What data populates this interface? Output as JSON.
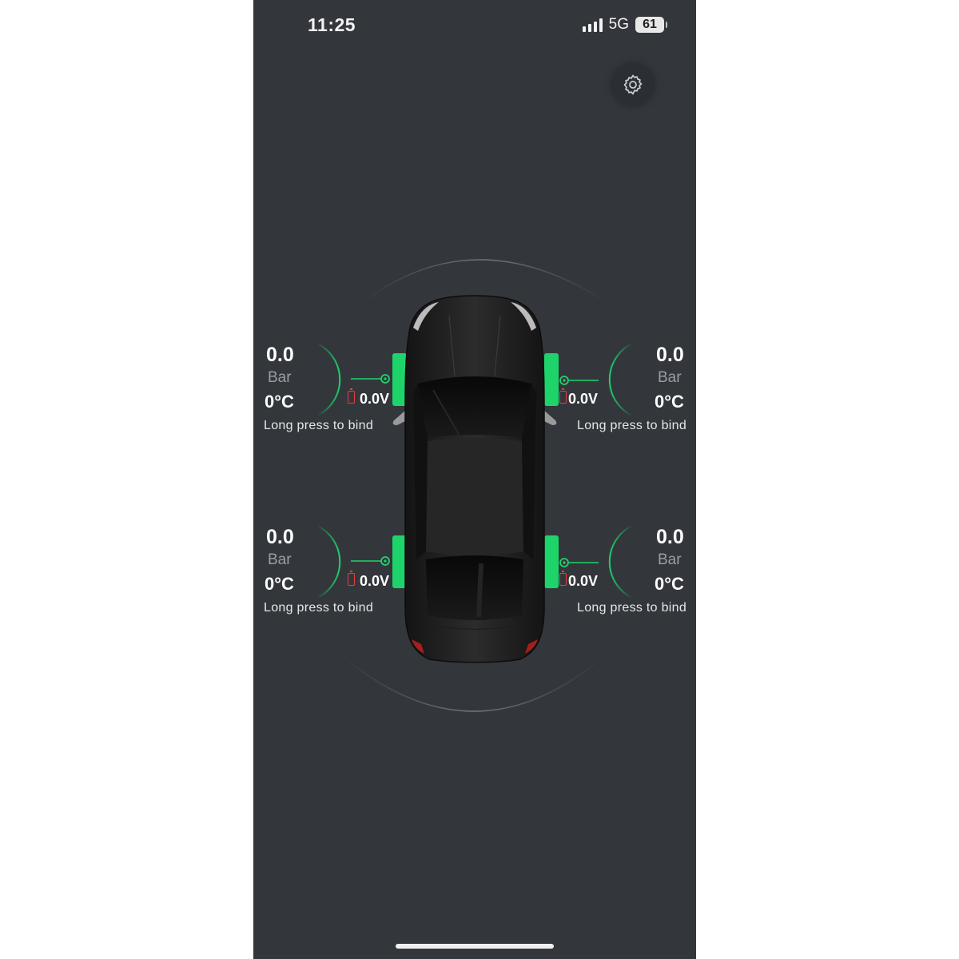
{
  "status_bar": {
    "time": "11:25",
    "network": "5G",
    "battery_level": "61",
    "signal_bars": 4
  },
  "settings": {
    "icon": "gear-icon"
  },
  "tires": {
    "front_left": {
      "pressure": "0.0",
      "unit": "Bar",
      "temperature": "0°C",
      "voltage": "0.0V",
      "hint": "Long press to bind"
    },
    "front_right": {
      "pressure": "0.0",
      "unit": "Bar",
      "temperature": "0°C",
      "voltage": "0.0V",
      "hint": "Long press to bind"
    },
    "rear_left": {
      "pressure": "0.0",
      "unit": "Bar",
      "temperature": "0°C",
      "voltage": "0.0V",
      "hint": "Long press to bind"
    },
    "rear_right": {
      "pressure": "0.0",
      "unit": "Bar",
      "temperature": "0°C",
      "voltage": "0.0V",
      "hint": "Long press to bind"
    }
  },
  "colors": {
    "background": "#33373c",
    "tire_ok": "#1fd36b",
    "low_battery": "#e0413a"
  }
}
